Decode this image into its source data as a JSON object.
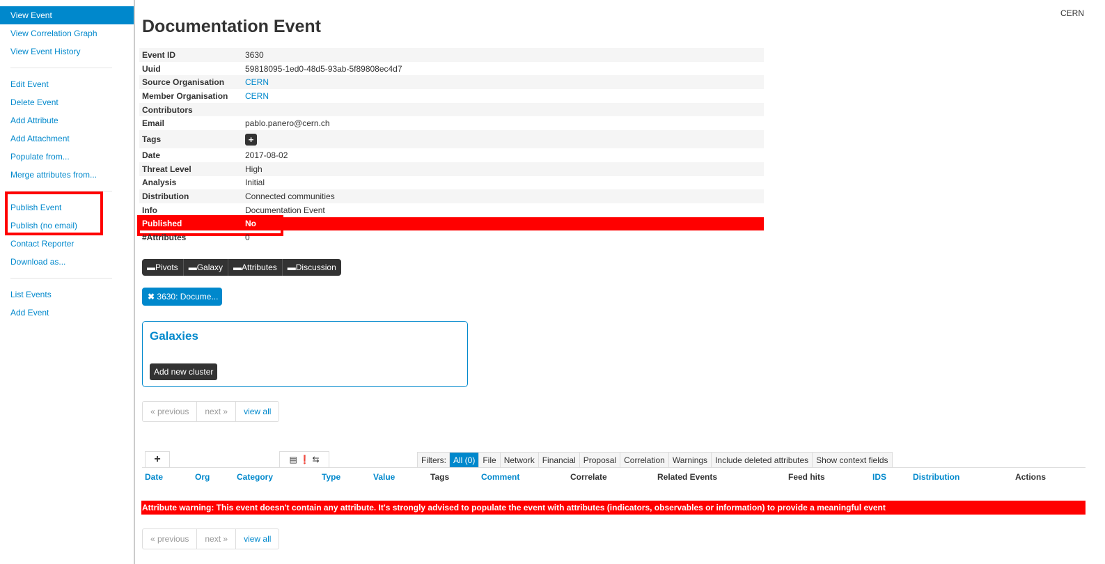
{
  "org_name": "CERN",
  "sidebar": {
    "group1": [
      "View Event",
      "View Correlation Graph",
      "View Event History"
    ],
    "group2": [
      "Edit Event",
      "Delete Event",
      "Add Attribute",
      "Add Attachment",
      "Populate from...",
      "Merge attributes from..."
    ],
    "group3": [
      "Publish Event",
      "Publish (no email)",
      "Contact Reporter",
      "Download as..."
    ],
    "group4": [
      "List Events",
      "Add Event"
    ]
  },
  "event": {
    "title": "Documentation Event",
    "labels": {
      "event_id": "Event ID",
      "uuid": "Uuid",
      "source_org": "Source Organisation",
      "member_org": "Member Organisation",
      "contributors": "Contributors",
      "email": "Email",
      "tags": "Tags",
      "date": "Date",
      "threat_level": "Threat Level",
      "analysis": "Analysis",
      "distribution": "Distribution",
      "info": "Info",
      "published": "Published",
      "attributes_count": "#Attributes"
    },
    "values": {
      "event_id": "3630",
      "uuid": "59818095-1ed0-48d5-93ab-5f89808ec4d7",
      "source_org": "CERN",
      "member_org": "CERN",
      "contributors": "",
      "email": "pablo.panero@cern.ch",
      "tags_add": "+",
      "date": "2017-08-02",
      "threat_level": "High",
      "analysis": "Initial",
      "distribution": "Connected communities",
      "info": "Documentation Event",
      "published": "No",
      "attributes_count": "0"
    }
  },
  "toggles": [
    "Pivots",
    "Galaxy",
    "Attributes",
    "Discussion"
  ],
  "pivot": {
    "label": "3630: Docume..."
  },
  "galaxies": {
    "title": "Galaxies",
    "add_button": "Add new cluster"
  },
  "pagination": {
    "previous": "« previous",
    "next": "next »",
    "view_all": "view all"
  },
  "attribute_tabs": {
    "add": "+"
  },
  "filters": {
    "label": "Filters:",
    "items": [
      "All (0)",
      "File",
      "Network",
      "Financial",
      "Proposal",
      "Correlation",
      "Warnings",
      "Include deleted attributes",
      "Show context fields"
    ]
  },
  "table_headers": [
    "Date",
    "Org",
    "Category",
    "Type",
    "Value",
    "Tags",
    "Comment",
    "Correlate",
    "Related Events",
    "Feed hits",
    "IDS",
    "Distribution",
    "Actions"
  ],
  "attribute_warning": "Attribute warning: This event doesn't contain any attribute. It's strongly advised to populate the event with attributes (indicators, observables or information) to provide a meaningful event",
  "colors": {
    "accent": "#0088cc",
    "alert": "#ff0000",
    "dark_button": "#333333"
  }
}
